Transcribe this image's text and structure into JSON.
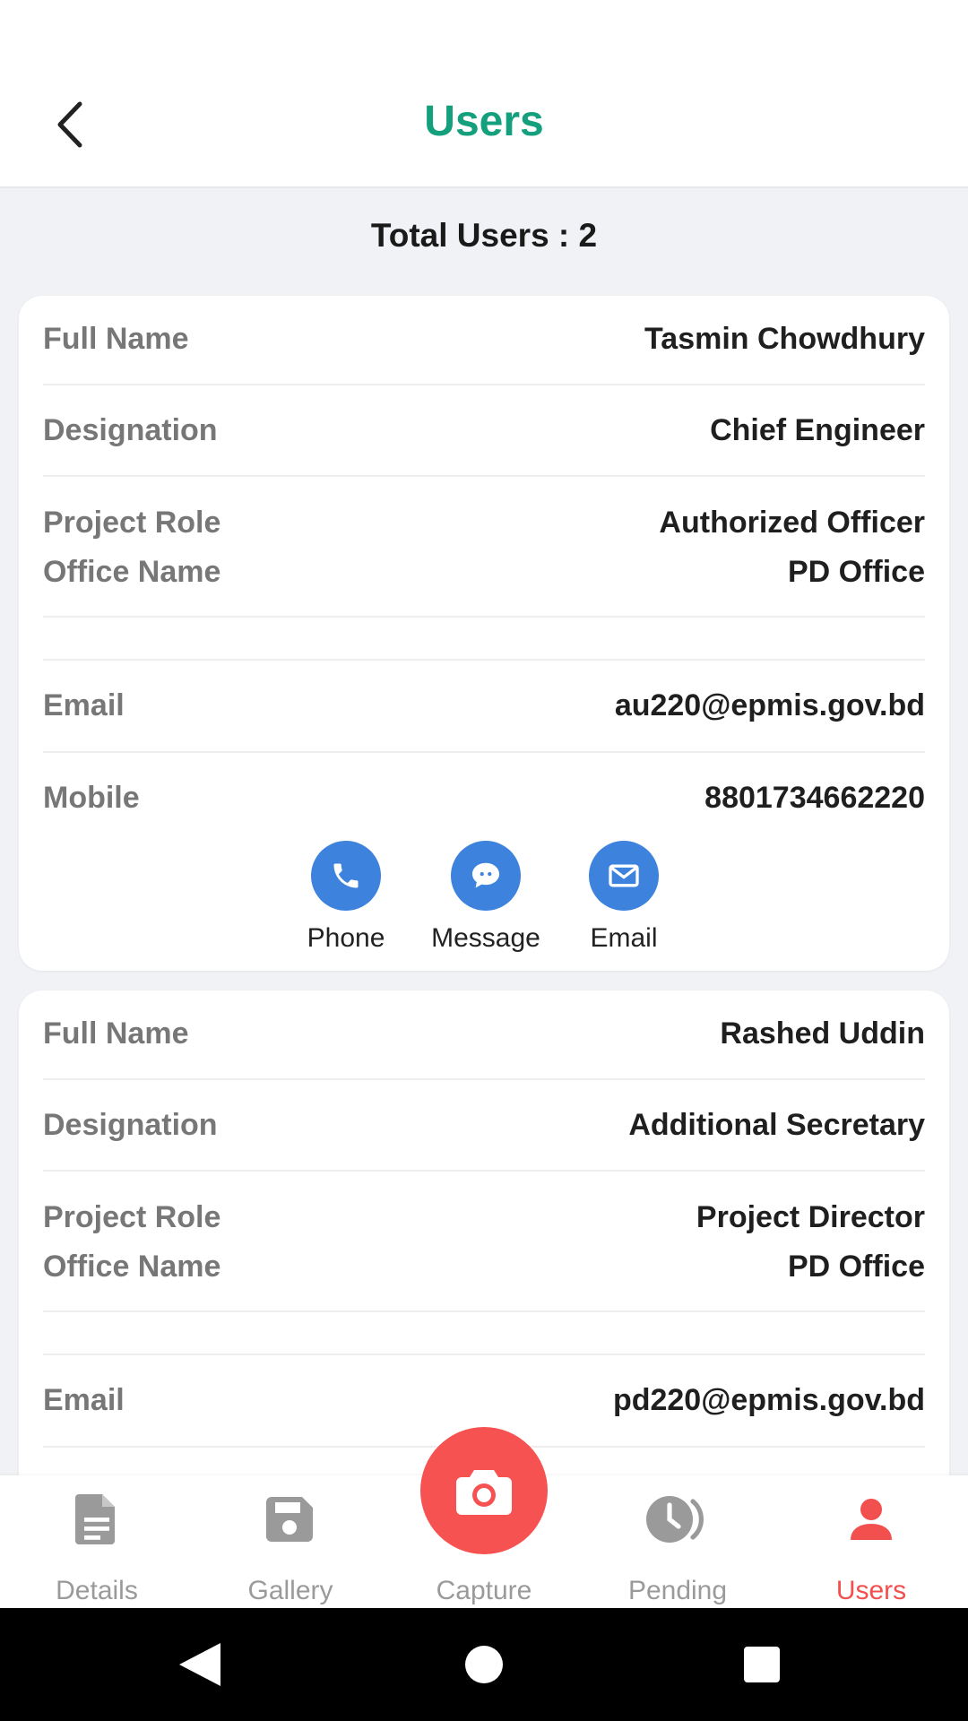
{
  "app_bar": {
    "title": "Users"
  },
  "summary": {
    "total_users": "Total Users : 2"
  },
  "field_labels": {
    "full_name": "Full Name",
    "designation": "Designation",
    "project_role": "Project Role",
    "office_name": "Office Name",
    "email": "Email",
    "mobile": "Mobile"
  },
  "actions": {
    "phone": "Phone",
    "message": "Message",
    "email": "Email"
  },
  "users": [
    {
      "full_name": "Tasmin Chowdhury",
      "designation": "Chief Engineer",
      "project_role": "Authorized Officer",
      "office_name": "PD Office",
      "email": "au220@epmis.gov.bd",
      "mobile": "8801734662220"
    },
    {
      "full_name": "Rashed Uddin",
      "designation": "Additional Secretary",
      "project_role": "Project Director",
      "office_name": "PD Office",
      "email": "pd220@epmis.gov.bd"
    }
  ],
  "bottom_nav": [
    {
      "label": "Details",
      "icon": "document-icon"
    },
    {
      "label": "Gallery",
      "icon": "save-icon"
    },
    {
      "label": "Capture",
      "icon": "camera-icon"
    },
    {
      "label": "Pending",
      "icon": "clock-icon"
    },
    {
      "label": "Users",
      "icon": "user-icon",
      "active": true
    }
  ],
  "colors": {
    "title_green": "#14a07c",
    "action_blue": "#3d82dc",
    "accent_red": "#f24f4f",
    "capture_red": "#f75252",
    "inactive_gray": "#9a9a9a"
  }
}
